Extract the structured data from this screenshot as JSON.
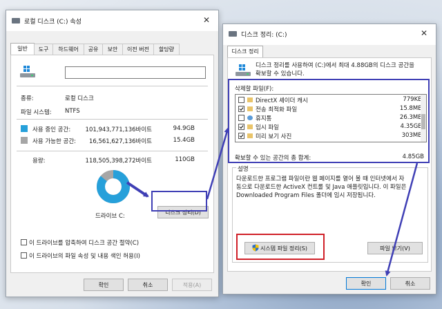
{
  "props": {
    "title": "로컬 디스크 (C:) 속성",
    "tabs": [
      "일반",
      "도구",
      "하드웨어",
      "공유",
      "보안",
      "이전 버전",
      "할당량"
    ],
    "type_label": "종류:",
    "type_value": "로컬 디스크",
    "fs_label": "파일 시스템:",
    "fs_value": "NTFS",
    "used_label": "사용 중인 공간:",
    "used_bytes": "101,943,771,136바이트",
    "used_gb": "94.9GB",
    "free_label": "사용 가능한 공간:",
    "free_bytes": "16,561,627,136바이트",
    "free_gb": "15.4GB",
    "capacity_label": "용량:",
    "capacity_bytes": "118,505,398,272바이트",
    "capacity_gb": "110GB",
    "drive_label": "드라이브 C:",
    "cleanup_button": "디스크 정리(D)",
    "compress_label": "이 드라이브를 압축하여 디스크 공간 절약(C)",
    "index_label": "이 드라이브의 파일 속성 및 내용 색인 허용(I)",
    "ok": "확인",
    "cancel": "취소",
    "apply": "적용(A)",
    "used_fraction": 0.86,
    "used_color": "#26a0da",
    "free_color": "#a6a6a6"
  },
  "cleanup": {
    "title": "디스크 정리: (C:)",
    "tab": "디스크 정리",
    "intro": [
      "디스크 정리를 사용하여 (C:)에서 최대 4.88GB의 디스크 공간을",
      "확보할 수 있습니다."
    ],
    "files_label": "삭제할 파일(F):",
    "files": [
      {
        "name": "DirectX 셰이더 캐시",
        "size": "779KB",
        "checked": false,
        "icon": "folder-icon"
      },
      {
        "name": "전송 최적화 파일",
        "size": "15.8MB",
        "checked": true,
        "icon": "folder-icon"
      },
      {
        "name": "휴지통",
        "size": "26.3MB",
        "checked": false,
        "icon": "recycle-bin-icon"
      },
      {
        "name": "임시 파일",
        "size": "4.35GB",
        "checked": true,
        "icon": "folder-icon"
      },
      {
        "name": "미리 보기 사진",
        "size": "303MB",
        "checked": true,
        "icon": "folder-icon"
      }
    ],
    "total_label": "확보할 수 있는 공간의 총 합계:",
    "total_value": "4.85GB",
    "desc_label": "설명",
    "desc": [
      "다운로드한 프로그램 파일이란 웹 페이지를 열어 볼 때 인터넷에서 자",
      "동으로 다운로드한 ActiveX 컨트롤 및 Java 애플릿입니다. 이 파일은",
      "Downloaded Program Files 폴더에 임시 저장됩니다."
    ],
    "system_button": "시스템 파일 정리(S)",
    "view_button": "파일 보기(V)",
    "ok": "확인",
    "cancel": "취소"
  }
}
